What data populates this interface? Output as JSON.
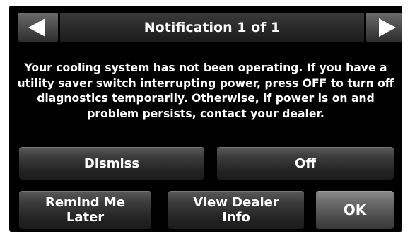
{
  "header": {
    "title": "Notification 1 of 1",
    "prev_icon": "left-arrow",
    "next_icon": "right-arrow"
  },
  "message": "Your cooling system has not been operating. If you have a utility saver switch interrupting power, press OFF to turn off diagnostics temporarily. Otherwise, if power is on and problem persists, contact your dealer.",
  "buttons": {
    "dismiss": "Dismiss",
    "off": "Off",
    "remind_line1": "Remind Me",
    "remind_line2": "Later",
    "dealer_line1": "View Dealer",
    "dealer_line2": "Info",
    "ok": "OK"
  },
  "colors": {
    "background": "#000000",
    "text": "#ffffff"
  }
}
